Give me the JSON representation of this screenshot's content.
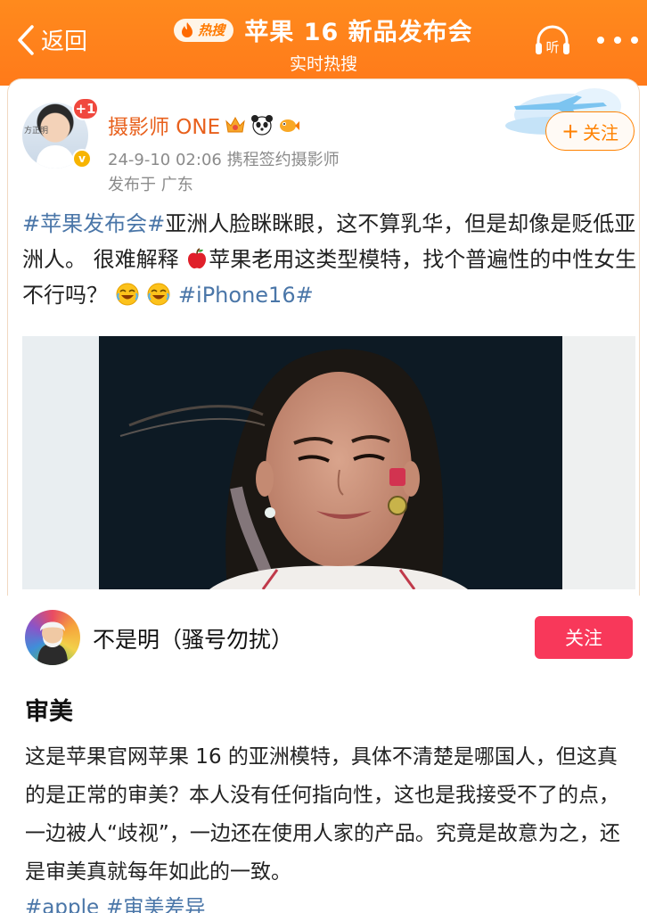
{
  "header": {
    "back_label": "返回",
    "hot_badge": "热搜",
    "title": "苹果 16 新品发布会",
    "subtitle": "实时热搜",
    "listen_label": "听"
  },
  "post": {
    "author": "摄影师 ONE",
    "notification_count": "+1",
    "avatar_tag": "方正明",
    "meta": "24-9-10 02:06  携程签约摄影师",
    "location": "发布于 广东",
    "follow_label": "关注",
    "text": {
      "tag1": "#苹果发布会#",
      "part1": "亚洲人脸眯眯眼，这不算乳华，但是却像是贬低亚洲人。 很难解释",
      "part2": "苹果老用这类型模特，找个普遍性的中性女生不行吗？",
      "tag2": "#iPhone16#"
    }
  },
  "comment": {
    "author": "不是明（骚号勿扰）",
    "follow_label": "关注",
    "heading": "审美",
    "body": "这是苹果官网苹果 16 的亚洲模特，具体不清楚是哪国人，但这真的是正常的审美？本人没有任何指向性，这也是我接受不了的点，一边被人“歧视”，一边还在使用人家的产品。究竟是故意为之，还是审美真就每年如此的一致。",
    "tags": [
      "#apple",
      "#审美差异"
    ]
  },
  "colors": {
    "header_orange": "#ff7a1a",
    "link_blue": "#4a76a8",
    "follow_orange": "#ff8200",
    "follow_pink": "#f8385a",
    "username_orange": "#e8601c"
  }
}
